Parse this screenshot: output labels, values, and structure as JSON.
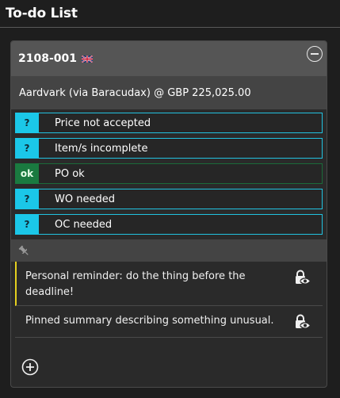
{
  "page": {
    "title": "To-do List"
  },
  "card": {
    "id": "2108-001",
    "flag_icon": "uk-flag-icon",
    "summary": "Aardvark (via Baracudax) @ GBP 225,025.00"
  },
  "statuses": [
    {
      "badge": "?",
      "label": "Price not accepted",
      "state": "pending"
    },
    {
      "badge": "?",
      "label": "Item/s incomplete",
      "state": "pending"
    },
    {
      "badge": "ok",
      "label": "PO ok",
      "state": "ok"
    },
    {
      "badge": "?",
      "label": "WO needed",
      "state": "pending"
    },
    {
      "badge": "?",
      "label": "OC needed",
      "state": "pending"
    }
  ],
  "notes": [
    {
      "text": "Personal reminder: do the thing before the deadline!",
      "icon": "private-lock-eye-icon"
    },
    {
      "text": "Pinned summary describing something unusual.",
      "icon": "private-lock-eye-icon"
    }
  ],
  "colors": {
    "pending": "#1bc7e8",
    "ok": "#1a7a40",
    "note_accent": "#e5d11f"
  }
}
